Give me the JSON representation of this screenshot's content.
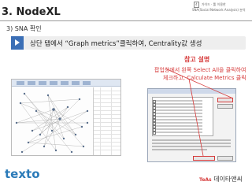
{
  "header": {
    "title": "3. NodeXL",
    "page_number": "4",
    "meta_prefix": "가이드 · 툴 이용한",
    "meta_line2": "SNA(Social Network Analysis) 분석"
  },
  "section": {
    "subtitle": "3) SNA 확인"
  },
  "banner": {
    "text": "상단 탭에서 “Graph metrics”클릭하여, Centrality값 생성"
  },
  "note": {
    "title": "참고 설명",
    "line1": "팝업창에서 왼쪽 Select All을 클릭하여",
    "line2": "체크하고, Calculate Metrics 클릭"
  },
  "logos": {
    "left_brand": "texto",
    "right_brand": "데이타앤씨",
    "right_mark": "TeAs"
  }
}
